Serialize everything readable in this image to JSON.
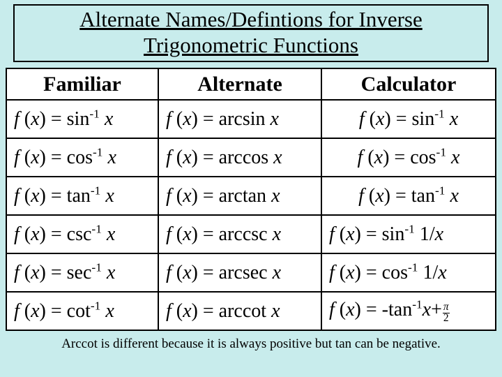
{
  "title": {
    "line1": "Alternate Names/Defintions for Inverse",
    "line2": "Trigonometric Functions"
  },
  "headers": {
    "col1": "Familiar",
    "col2": "Alternate",
    "col3": "Calculator"
  },
  "rows": [
    {
      "fam_fn": "sin",
      "alt_fn": "arcsin",
      "calc_fn": "sin",
      "calc_arg": "x",
      "calc_neg": false,
      "calc_tail": ""
    },
    {
      "fam_fn": "cos",
      "alt_fn": "arccos",
      "calc_fn": "cos",
      "calc_arg": "x",
      "calc_neg": false,
      "calc_tail": ""
    },
    {
      "fam_fn": "tan",
      "alt_fn": "arctan",
      "calc_fn": "tan",
      "calc_arg": "x",
      "calc_neg": false,
      "calc_tail": ""
    },
    {
      "fam_fn": "csc",
      "alt_fn": "arccsc",
      "calc_fn": "sin",
      "calc_arg": "1/x",
      "calc_neg": false,
      "calc_tail": ""
    },
    {
      "fam_fn": "sec",
      "alt_fn": "arcsec",
      "calc_fn": "cos",
      "calc_arg": "1/x",
      "calc_neg": false,
      "calc_tail": ""
    },
    {
      "fam_fn": "cot",
      "alt_fn": "arccot",
      "calc_fn": "tan",
      "calc_arg": "x",
      "calc_neg": true,
      "calc_tail": "halfpi"
    }
  ],
  "footnote": "Arccot is different because it is always positive but tan can be negative.",
  "chart_data": {
    "type": "table",
    "title": "Alternate Names/Defintions for Inverse Trigonometric Functions",
    "columns": [
      "Familiar",
      "Alternate",
      "Calculator"
    ],
    "rows": [
      [
        "f(x) = sin^-1 x",
        "f(x) = arcsin x",
        "f(x) = sin^-1 x"
      ],
      [
        "f(x) = cos^-1 x",
        "f(x) = arccos x",
        "f(x) = cos^-1 x"
      ],
      [
        "f(x) = tan^-1 x",
        "f(x) = arctan x",
        "f(x) = tan^-1 x"
      ],
      [
        "f(x) = csc^-1 x",
        "f(x) = arccsc x",
        "f(x) = sin^-1 1/x"
      ],
      [
        "f(x) = sec^-1 x",
        "f(x) = arcsec x",
        "f(x) = cos^-1 1/x"
      ],
      [
        "f(x) = cot^-1 x",
        "f(x) = arccot x",
        "f(x) = -tan^-1 x + π/2"
      ]
    ],
    "footnote": "Arccot is different because it is always positive but tan can be negative."
  }
}
